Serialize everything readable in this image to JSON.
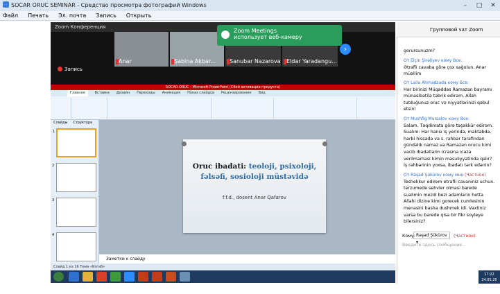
{
  "window": {
    "title": "SOCAR ORUC SEMINAR - Средство просмотра фотографий Windows"
  },
  "menu": {
    "items": [
      "Файл",
      "Печать",
      "Эл. почта",
      "Запись",
      "Открыть"
    ]
  },
  "zoom": {
    "title": "Zoom Конференция",
    "participants": [
      {
        "name": "Anar"
      },
      {
        "name": "Sabina Akbar..."
      },
      {
        "name": "Sanubar Nazarova"
      },
      {
        "name": "Eldar Yaradangu..."
      }
    ],
    "recording": "Запись",
    "notification": {
      "title": "Zoom Meetings",
      "text": "использует веб-камеру"
    }
  },
  "ppt": {
    "title_bar": "SOCAR ORUC - Microsoft PowerPoint (Сбой активации продукта)",
    "tabs": [
      "Главная",
      "Вставка",
      "Дизайн",
      "Переходы",
      "Анимация",
      "Показ слайдов",
      "Рецензирование",
      "Вид"
    ],
    "panel_tabs": [
      "Слайды",
      "Структура"
    ],
    "slide": {
      "title_black": "Oruc ibadati: ",
      "title_blue": "teoloji, psixoloji, fəlsəfi, sosioloji müstəvidə",
      "author": "f.f.d., dosent Anar Qafarov"
    },
    "notes_placeholder": "Заметки к слайду",
    "status": "Слайд 1 из 16    Тема «Изгиб»",
    "thumb_numbers": [
      "1",
      "2",
      "3",
      "4"
    ]
  },
  "chat": {
    "header": "Групповой чат Zoom",
    "messages": [
      {
        "from": "",
        "to": "",
        "text": "gorursunuzm?"
      },
      {
        "from": "Elçin Şirəliyev",
        "to": "Все",
        "text": "Ətrafli cavaba görə çox sağolun. Anar müəllim"
      },
      {
        "from": "Laila Ahmadzada",
        "to": "Все",
        "text": "Hər birinizi Müqəddəs Ramazan bayramı münasibətilə təbrik edirəm. Allah tutduğunuz oruc və niyyətlərinizi qəbul etsin!"
      },
      {
        "from": "Mushfig Mursalov",
        "to": "Все",
        "text": "Salam. Təqdimata görə təşəkkür edirəm. Sualım: Hər hansı iş yerində, məktəbdə, hərbi hissədə və s. rəhbər tərəfindən gündəlik namaz və Ramazan orucu kimi vacib ibadətlərin icrasına  icazə verilməməsi kimin məsuliyyətində qalır? İş rəhbərinin yoxsa, ibadətı tərk edənin?"
      },
      {
        "from": "Rəşad Şükürov",
        "to": "мне",
        "private": "(Частное)",
        "text": "Teshekkur edirem etrafli cavaniniz uchun. terzumede sehvler olmasi barede sualimin mezdi bezi adamlarin hetta Allahi dizine kimi gorecek cumlesinin menasini basha dushmek idi. Vaxtiniz varsa bu barede qisa bir fikr soyleye bilersiniz?"
      }
    ],
    "to_label": "Кому:",
    "to_value": "Rəşad Şükürov ▾",
    "private_label": "(Частное)",
    "input_placeholder": "Введите здесь сообщение..."
  },
  "clock": {
    "time": "17:22",
    "date": "24.05.20"
  }
}
